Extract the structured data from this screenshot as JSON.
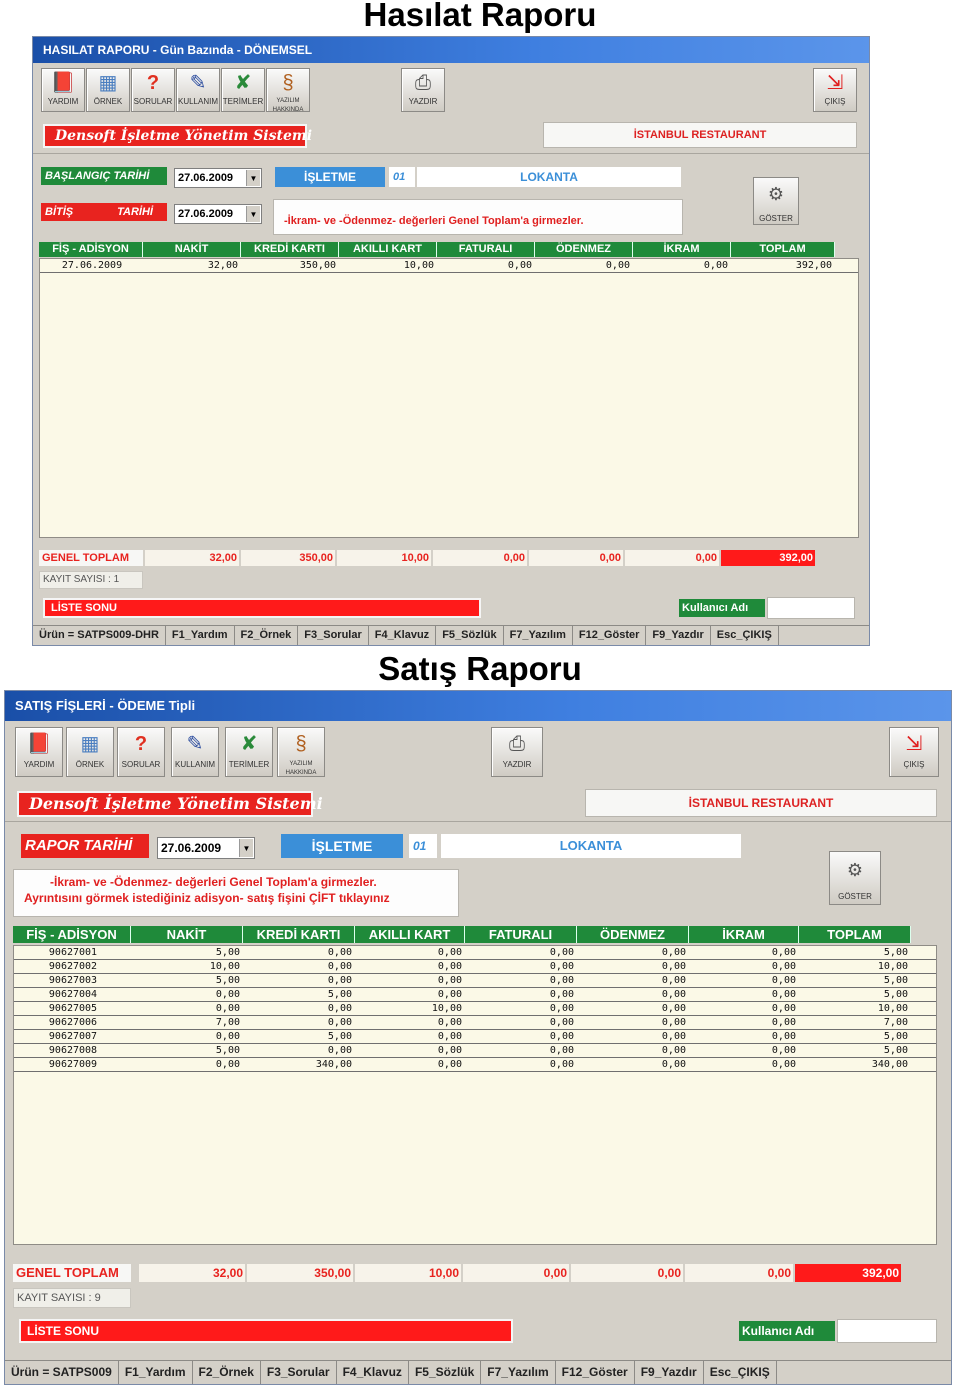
{
  "section1_heading": "Hasılat Raporu",
  "section2_heading": "Satış Raporu",
  "hasilat": {
    "window_title": "HASILAT RAPORU  -  Gün Bazında  -  DÖNEMSEL",
    "toolbar": [
      {
        "label": "YARDIM",
        "icon": "help-book-icon"
      },
      {
        "label": "ÖRNEK",
        "icon": "grid-sample-icon"
      },
      {
        "label": "SORULAR",
        "icon": "question-icon"
      },
      {
        "label": "KULLANIM",
        "icon": "usage-icon"
      },
      {
        "label": "TERİMLER",
        "icon": "terms-icon"
      },
      {
        "label": "YAZILIM HAKKINDA",
        "icon": "seahorse-icon"
      },
      {
        "label": "YAZDIR",
        "icon": "printer-icon"
      },
      {
        "label": "ÇIKIŞ",
        "icon": "exit-icon"
      }
    ],
    "brand": "Densoft   İşletme  Yönetim  Sistemi",
    "restaurant": "İSTANBUL RESTAURANT",
    "start_label": "BAŞLANGIÇ TARİHİ",
    "start_date": "27.06.2009",
    "end_label_1": "BİTİŞ",
    "end_label_2": "TARİHİ",
    "end_date": "27.06.2009",
    "isletme_label": "İŞLETME",
    "isletme_code": "01",
    "isletme_name": "LOKANTA",
    "note": "-İkram- ve -Ödenmez- değerleri Genel Toplam'a girmezler.",
    "goster": "GÖSTER",
    "columns": [
      "FİŞ  -  ADİSYON",
      "NAKİT",
      "KREDİ  KARTI",
      "AKILLI  KART",
      "FATURALI",
      "ÖDENMEZ",
      "İKRAM",
      "TOPLAM"
    ],
    "rows": [
      [
        "27.06.2009",
        "32,00",
        "350,00",
        "10,00",
        "0,00",
        "0,00",
        "0,00",
        "392,00"
      ]
    ],
    "totals_label": "GENEL  TOPLAM",
    "totals": [
      "32,00",
      "350,00",
      "10,00",
      "0,00",
      "0,00",
      "0,00",
      "392,00"
    ],
    "kayit": "KAYIT SAYISI :     1",
    "liste_sonu": "LİSTE SONU",
    "user_label": "Kullanıcı Adı",
    "status": [
      "Ürün = SATPS009-DHR",
      "F1_Yardım",
      "F2_Örnek",
      "F3_Sorular",
      "F4_Klavuz",
      "F5_Sözlük",
      "F7_Yazılım",
      "F12_Göster",
      "F9_Yazdır",
      "Esc_ÇIKIŞ"
    ]
  },
  "satis": {
    "window_title": "SATIŞ FİŞLERİ  - ÖDEME Tipli",
    "toolbar": [
      {
        "label": "YARDIM",
        "icon": "help-book-icon"
      },
      {
        "label": "ÖRNEK",
        "icon": "grid-sample-icon"
      },
      {
        "label": "SORULAR",
        "icon": "question-icon"
      },
      {
        "label": "KULLANIM",
        "icon": "usage-icon"
      },
      {
        "label": "TERİMLER",
        "icon": "terms-icon"
      },
      {
        "label": "YAZILIM HAKKINDA",
        "icon": "seahorse-icon"
      },
      {
        "label": "YAZDIR",
        "icon": "printer-icon"
      },
      {
        "label": "ÇIKIŞ",
        "icon": "exit-icon"
      }
    ],
    "brand": "Densoft   İşletme  Yönetim  Sistemi",
    "restaurant": "İSTANBUL RESTAURANT",
    "date_label": "RAPOR TARİHİ",
    "date": "27.06.2009",
    "isletme_label": "İŞLETME",
    "isletme_code": "01",
    "isletme_name": "LOKANTA",
    "note_1": "-İkram- ve -Ödenmez- değerleri Genel Toplam'a girmezler.",
    "note_2": "Ayrıntısını görmek istediğiniz adisyon- satış fişini  ÇİFT tıklayınız",
    "goster": "GÖSTER",
    "columns": [
      "FİŞ  -  ADİSYON",
      "NAKİT",
      "KREDİ  KARTI",
      "AKILLI  KART",
      "FATURALI",
      "ÖDENMEZ",
      "İKRAM",
      "TOPLAM"
    ],
    "rows": [
      [
        "90627001",
        "5,00",
        "0,00",
        "0,00",
        "0,00",
        "0,00",
        "0,00",
        "5,00"
      ],
      [
        "90627002",
        "10,00",
        "0,00",
        "0,00",
        "0,00",
        "0,00",
        "0,00",
        "10,00"
      ],
      [
        "90627003",
        "5,00",
        "0,00",
        "0,00",
        "0,00",
        "0,00",
        "0,00",
        "5,00"
      ],
      [
        "90627004",
        "0,00",
        "5,00",
        "0,00",
        "0,00",
        "0,00",
        "0,00",
        "5,00"
      ],
      [
        "90627005",
        "0,00",
        "0,00",
        "10,00",
        "0,00",
        "0,00",
        "0,00",
        "10,00"
      ],
      [
        "90627006",
        "7,00",
        "0,00",
        "0,00",
        "0,00",
        "0,00",
        "0,00",
        "7,00"
      ],
      [
        "90627007",
        "0,00",
        "5,00",
        "0,00",
        "0,00",
        "0,00",
        "0,00",
        "5,00"
      ],
      [
        "90627008",
        "5,00",
        "0,00",
        "0,00",
        "0,00",
        "0,00",
        "0,00",
        "5,00"
      ],
      [
        "90627009",
        "0,00",
        "340,00",
        "0,00",
        "0,00",
        "0,00",
        "0,00",
        "340,00"
      ]
    ],
    "totals_label": "GENEL  TOPLAM",
    "totals": [
      "32,00",
      "350,00",
      "10,00",
      "0,00",
      "0,00",
      "0,00",
      "392,00"
    ],
    "kayit": "KAYIT SAYISI :    9",
    "liste_sonu": "LİSTE SONU",
    "user_label": "Kullanıcı Adı",
    "status": [
      "Ürün = SATPS009",
      "F1_Yardım",
      "F2_Örnek",
      "F3_Sorular",
      "F4_Klavuz",
      "F5_Sözlük",
      "F7_Yazılım",
      "F12_Göster",
      "F9_Yazdır",
      "Esc_ÇIKIŞ"
    ]
  }
}
